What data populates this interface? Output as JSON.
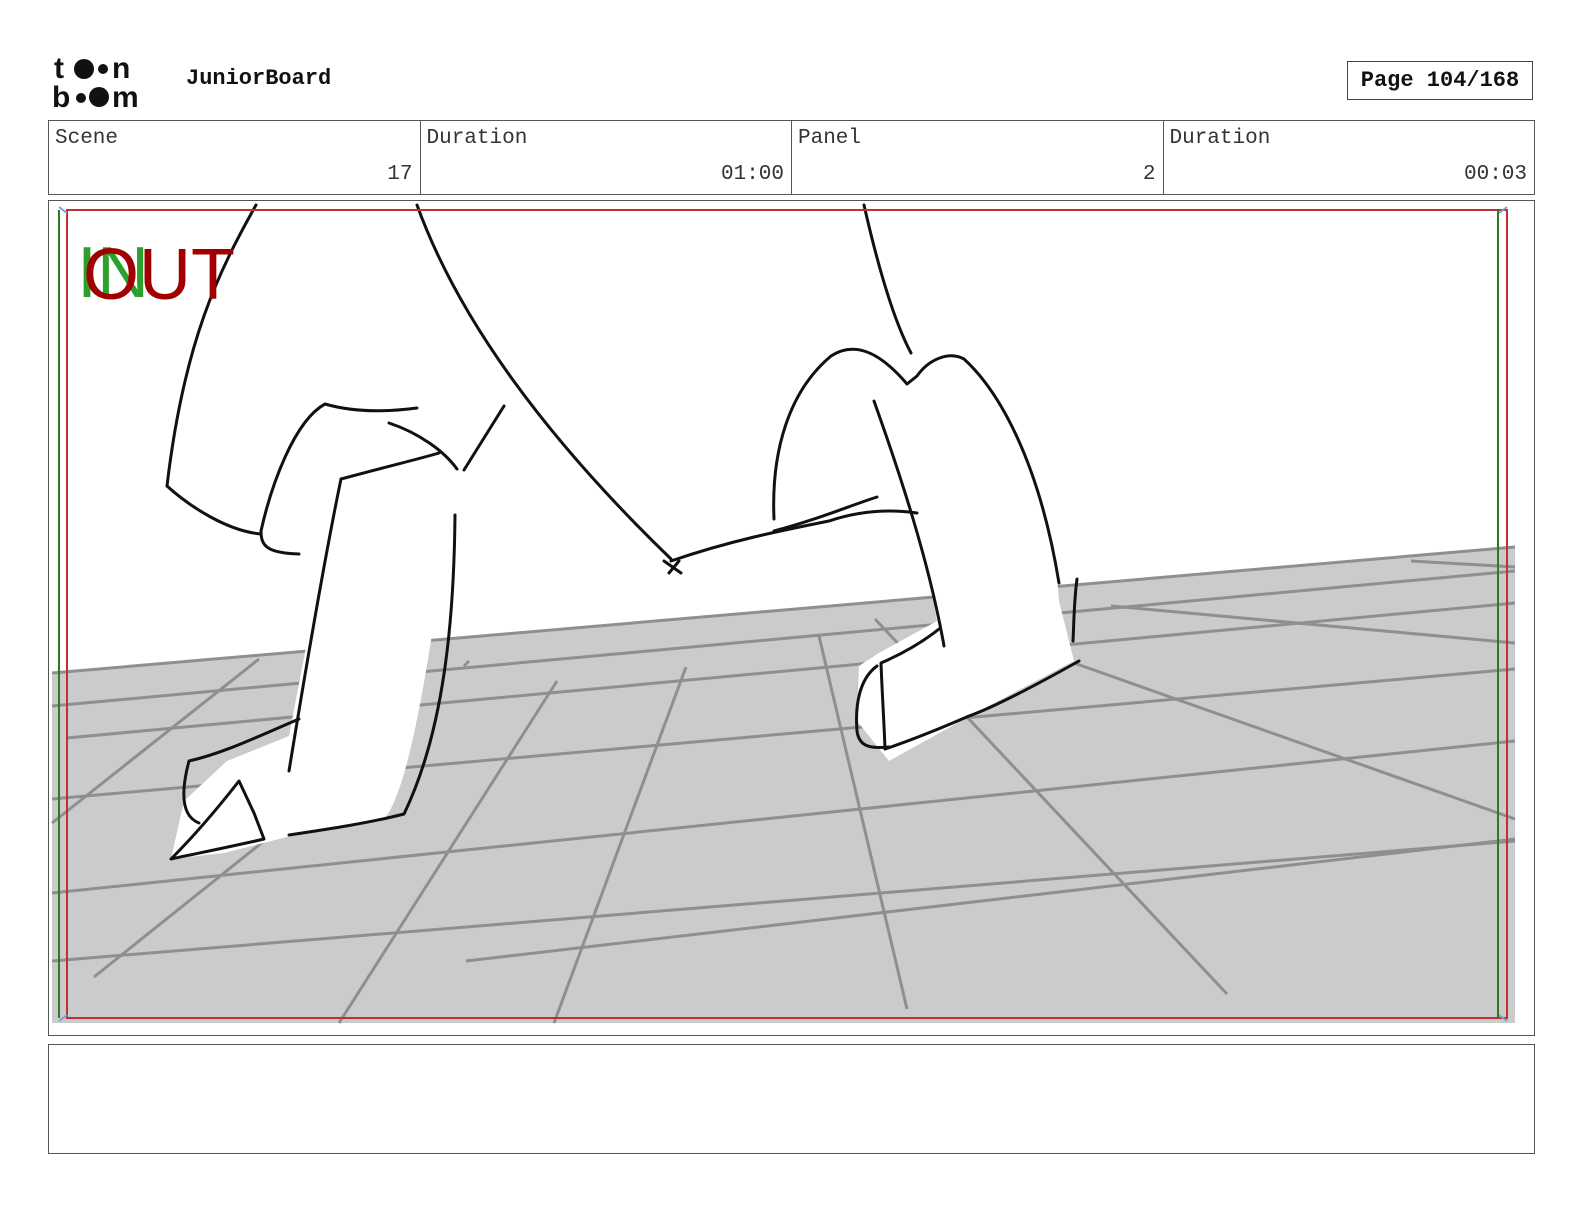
{
  "header": {
    "logo_text": "toon boom",
    "app_name": "JuniorBoard",
    "page_label": "Page 104/168"
  },
  "info": {
    "scene_label": "Scene",
    "scene_value": "17",
    "scene_duration_label": "Duration",
    "scene_duration_value": "01:00",
    "panel_label": "Panel",
    "panel_value": "2",
    "panel_duration_label": "Duration",
    "panel_duration_value": "00:03"
  },
  "panel": {
    "in_marker": "IN",
    "out_marker": "OUT",
    "colors": {
      "in": "#2ca02c",
      "out": "#a00000",
      "floor": "#cbcbcb",
      "floor_lines": "#8f8f8f",
      "frame_red": "#c03030",
      "frame_green": "#2a7a2a"
    }
  },
  "notes": {
    "text": ""
  }
}
